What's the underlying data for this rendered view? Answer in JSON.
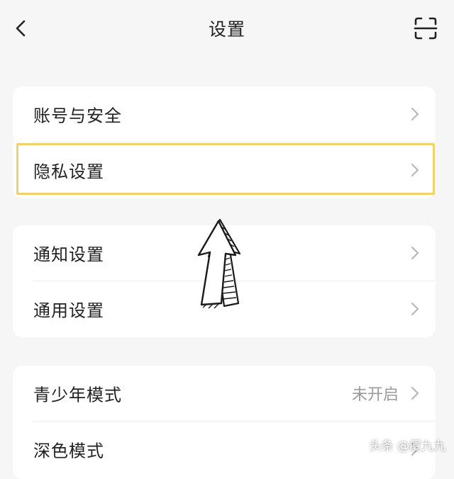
{
  "header": {
    "title": "设置",
    "back_icon": "chevron-left-icon",
    "scan_icon": "scan-icon"
  },
  "groups": [
    {
      "items": [
        {
          "label": "账号与安全",
          "icon": "chevron-right-icon"
        },
        {
          "label": "隐私设置",
          "icon": "chevron-right-icon",
          "highlighted": true
        }
      ]
    },
    {
      "items": [
        {
          "label": "通知设置",
          "icon": "chevron-right-icon"
        },
        {
          "label": "通用设置",
          "icon": "chevron-right-icon"
        }
      ]
    },
    {
      "items": [
        {
          "label": "青少年模式",
          "value": "未开启",
          "icon": "chevron-right-icon"
        },
        {
          "label": "深色模式",
          "icon": "chevron-right-icon"
        }
      ]
    }
  ],
  "annotation": {
    "highlight_color": "#efd36a",
    "arrow_icon": "hand-drawn-up-arrow-icon"
  },
  "watermark": "头条 @厦九九"
}
